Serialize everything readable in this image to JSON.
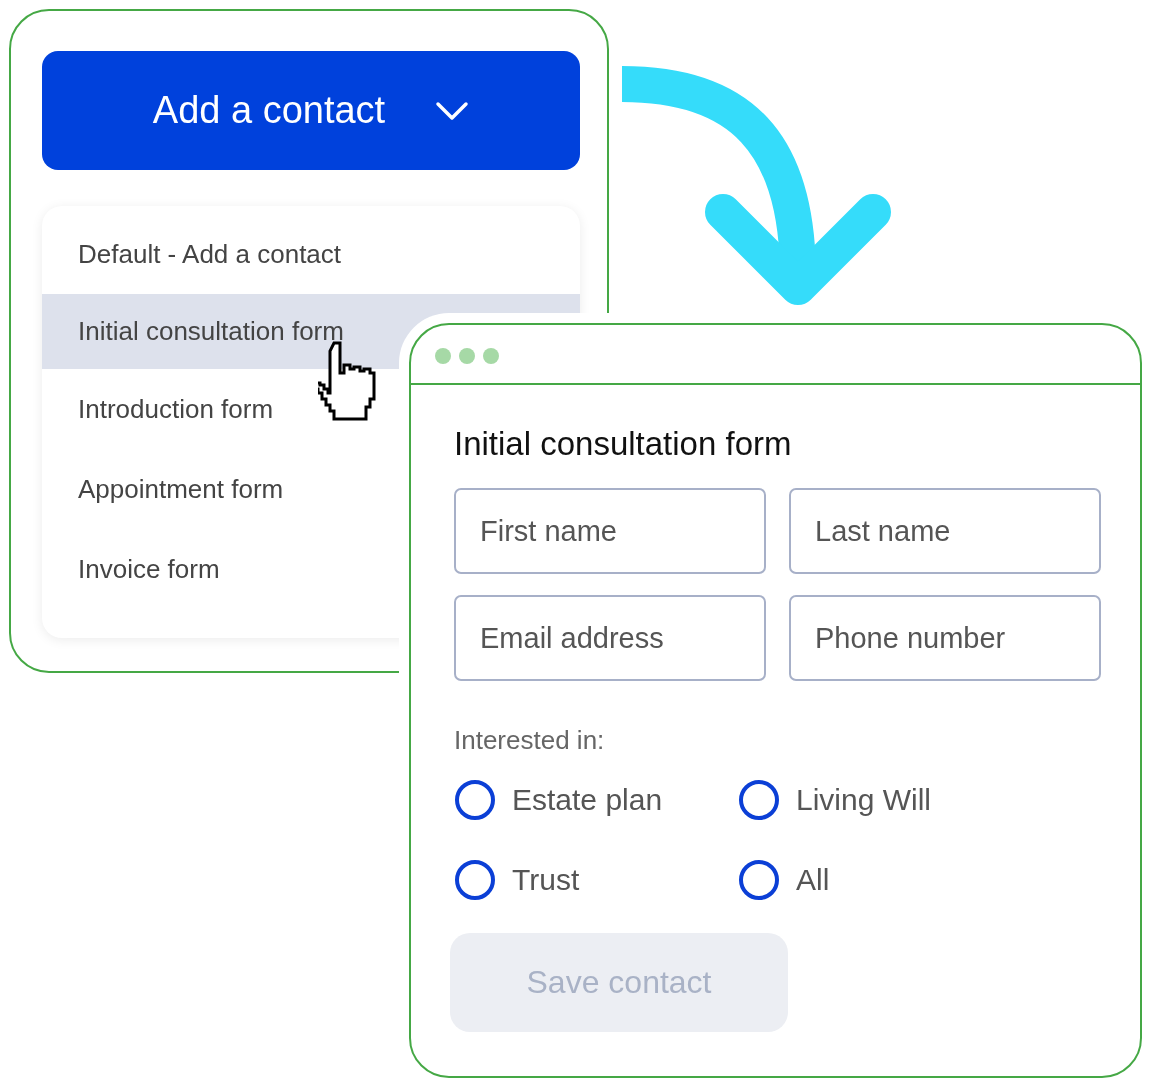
{
  "menu_button": {
    "label": "Add a contact"
  },
  "menu_items": [
    {
      "label": "Default - Add a contact",
      "selected": false
    },
    {
      "label": "Initial consultation form",
      "selected": true
    },
    {
      "label": "Introduction form",
      "selected": false
    },
    {
      "label": "Appointment form",
      "selected": false
    },
    {
      "label": "Invoice form",
      "selected": false
    }
  ],
  "form": {
    "title": "Initial consultation form",
    "fields": [
      {
        "placeholder": "First name"
      },
      {
        "placeholder": "Last name"
      },
      {
        "placeholder": "Email address"
      },
      {
        "placeholder": "Phone number"
      }
    ],
    "interest_label": "Interested in:",
    "options": [
      {
        "label": "Estate plan",
        "checked": false
      },
      {
        "label": "Living Will",
        "checked": false
      },
      {
        "label": "Trust",
        "checked": false
      },
      {
        "label": "All",
        "checked": false
      }
    ],
    "save_button": {
      "label": "Save contact",
      "disabled": true
    }
  }
}
